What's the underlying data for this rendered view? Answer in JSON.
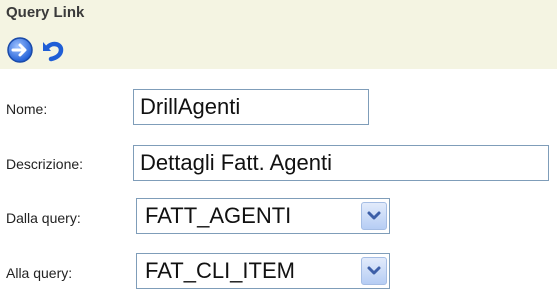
{
  "panel": {
    "title": "Query Link"
  },
  "toolbar": {
    "go_icon": "arrow-right-circle-icon",
    "undo_icon": "undo-arrow-icon"
  },
  "form": {
    "nome_label": "Nome:",
    "nome_value": "DrillAgenti",
    "descrizione_label": "Descrizione:",
    "descrizione_value": "Dettagli Fatt. Agenti",
    "dalla_query_label": "Dalla query:",
    "dalla_query_value": "FATT_AGENTI",
    "alla_query_label": "Alla query:",
    "alla_query_value": "FAT_CLI_ITEM"
  },
  "colors": {
    "header_background": "#f4f4e2",
    "field_border": "#7f9db9",
    "icon_blue": "#1f5ed6"
  }
}
